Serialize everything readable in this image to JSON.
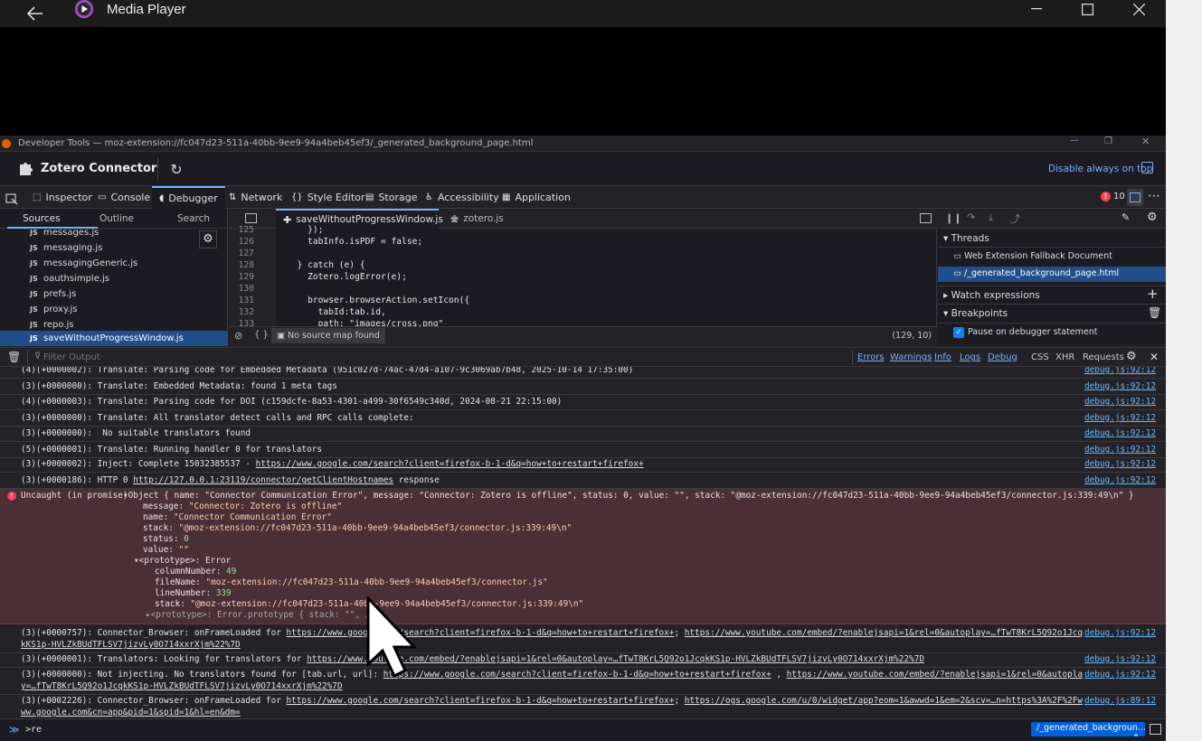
{
  "media_player": {
    "title": "Media Player"
  },
  "devtools": {
    "title": "Developer Tools — moz-extension://fc047d23-511a-40bb-9ee9-94a4beb45ef3/_generated_background_page.html",
    "extension_name": "Zotero Connector",
    "disable_on_top": "Disable always on top",
    "tabs": [
      "Inspector",
      "Console",
      "Debugger",
      "Network",
      "Style Editor",
      "Storage",
      "Accessibility",
      "Application"
    ],
    "error_count": "10",
    "source_tabs": [
      "Sources",
      "Outline",
      "Search"
    ],
    "files": [
      "messages.js",
      "messaging.js",
      "messagingGeneric.js",
      "oauthsimple.js",
      "prefs.js",
      "proxy.js",
      "repo.js",
      "saveWithoutProgressWindow.js"
    ],
    "file_badge": "JS",
    "editor_tabs": [
      "saveWithoutProgressWindow.js",
      "zotero.js"
    ],
    "code_lines": [
      {
        "n": "125",
        "t": "    });"
      },
      {
        "n": "126",
        "t": "    tabInfo.isPDF = false;"
      },
      {
        "n": "127",
        "t": ""
      },
      {
        "n": "128",
        "t": "  } catch (e) {"
      },
      {
        "n": "129",
        "t": "    Zotero.logError(e);"
      },
      {
        "n": "130",
        "t": ""
      },
      {
        "n": "131",
        "t": "    browser.browserAction.setIcon({"
      },
      {
        "n": "132",
        "t": "      tabId:tab.id,"
      },
      {
        "n": "133",
        "t": "      path: \"images/cross.png\""
      }
    ],
    "source_map": "No source map found",
    "cursor_pos": "(129, 10)",
    "threads_label": "Threads",
    "threads": [
      "Web Extension Fallback Document",
      "/_generated_background_page.html"
    ],
    "watch_label": "Watch expressions",
    "breakpoints_label": "Breakpoints",
    "pause_debugger": "Pause on debugger statement",
    "filter_placeholder": "Filter Output",
    "filters": [
      "Errors",
      "Warnings",
      "Info",
      "Logs",
      "Debug",
      "CSS",
      "XHR",
      "Requests"
    ],
    "console_input": ">re",
    "context_select": "/_generated_backgroun..."
  },
  "console": {
    "rows_top": [
      {
        "text": "(4)(+0000002): Translate: Parsing code for Embedded Metadata (951c027d-74ac-47d4-a107-9c3069ab7b48, 2025-10-14 17:35:00)",
        "loc": "debug.js:92:12"
      },
      {
        "text": "(3)(+0000000): Translate: Embedded Metadata: found 1 meta tags",
        "loc": "debug.js:92:12"
      },
      {
        "text": "(4)(+0000003): Translate: Parsing code for DOI (c159dcfe-8a53-4301-a499-30f6549c340d, 2024-08-21 22:15:00)",
        "loc": "debug.js:92:12"
      },
      {
        "text": "(3)(+0000000): Translate: All translator detect calls and RPC calls complete:",
        "loc": "debug.js:92:12"
      },
      {
        "text": "(3)(+0000000):  No suitable translators found",
        "loc": "debug.js:92:12"
      },
      {
        "text": "(5)(+0000001): Translate: Running handler 0 for translators",
        "loc": "debug.js:92:12"
      }
    ],
    "inject": {
      "pre": "(3)(+0000002): Inject: Complete 15032385537 - ",
      "link": "https://www.google.com/search?client=firefox-b-1-d&q=how+to+restart+firefox+",
      "loc": "debug.js:92:12"
    },
    "http": {
      "pre": "(3)(+0000186): HTTP 0 ",
      "link": "http://127.0.0.1:23119/connector/getClientHostnames",
      "post": " response",
      "loc": "debug.js:92:12"
    },
    "error": {
      "label": "Uncaught (in promise)",
      "summary": "Object { name: \"Connector Communication Error\", message: \"Connector: Zotero is offline\", status: 0, value: \"\", stack: \"@moz-extension://fc047d23-511a-40bb-9ee9-94a4beb45ef3/connector.js:339:49\\n\" }",
      "message": "\"Connector: Zotero is offline\"",
      "name": "\"Connector Communication Error\"",
      "stack": "\"@moz-extension://fc047d23-511a-40bb-9ee9-94a4beb45ef3/connector.js:339:49\\n\"",
      "status": "0",
      "value": "\"\"",
      "proto_label": "<prototype>: Error",
      "columnNumber": "49",
      "fileName": "\"moz-extension://fc047d23-511a-40bb-9ee9-94a4beb45ef3/connector.js\"",
      "lineNumber": "339",
      "stack2": "\"@moz-extension://fc047d23-511a-40bb-9ee9-94a4beb45ef3/connector.js:339:49\\n\"",
      "proto2": "<prototype>: Error.prototype { stack: \"\", … }"
    },
    "rows_bottom": [
      {
        "pre": "(3)(+0000757): Connector_Browser: onFrameLoaded for ",
        "l1": "https://www.google.com/search?client=firefox-b-1-d&q=how+to+restart+firefox+",
        "mid": "; ",
        "l2": "https://www.youtube.com/embed/?enablejsapi=1&rel=0&autoplay=…fTwT8KrL5Q92o1JcqkKS1p-HVLZkBUdTFLSV7jizvLy0O714xxrXjm%22%7D",
        "loc": "debug.js:92:12"
      },
      {
        "pre": "(3)(+0000001): Translators: Looking for translators for ",
        "l1": "https://www.youtube.com/embed/?enablejsapi=1&rel=0&autoplay=…fTwT8KrL5Q92o1JcqkKS1p-HVLZkBUdTFLSV7jizvLy0O714xxrXjm%22%7D",
        "mid": "",
        "l2": "",
        "loc": "debug.js:92:12"
      },
      {
        "pre": "(3)(+0000000): Not injecting. No translators found for [tab.url, url]: ",
        "l1": "https://www.google.com/search?client=firefox-b-1-d&q=how+to+restart+firefox+",
        "mid": " , ",
        "l2": "https://www.youtube.com/embed/?enablejsapi=1&rel=0&autoplay=…fTwT8KrL5Q92o1JcqkKS1p-HVLZkBUdTFLSV7jizvLy0O714xxrXjm%22%7D",
        "loc": "debug.js:92:12"
      },
      {
        "pre": "(3)(+0002226): Connector_Browser: onFrameLoaded for ",
        "l1": "https://www.google.com/search?client=firefox-b-1-d&q=how+to+restart+firefox+",
        "mid": "; ",
        "l2": "https://ogs.google.com/u/0/widget/app?eom=1&awwd=1&em=2&scv=…n=https%3A%2F%2Fwww.google.com&cn=app&pid=1&spid=1&hl=en&dm=",
        "loc": "debug.js:89:12"
      }
    ]
  },
  "colors": {
    "accent": "#74b0ff",
    "error_bg": "#4b2f36",
    "selected": "#204e8a",
    "error_icon": "#ff3b4f"
  }
}
